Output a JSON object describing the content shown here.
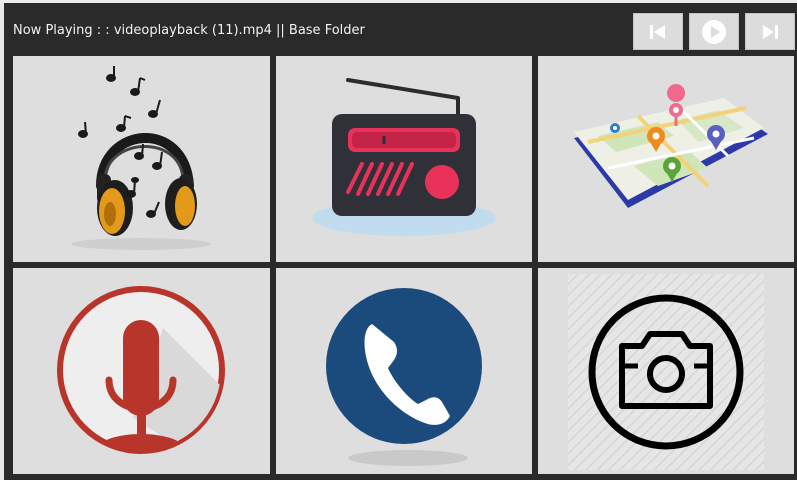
{
  "header": {
    "now_playing_text": "Now Playing : : videoplayback (11).mp4 || Base Folder"
  },
  "controls": [
    {
      "id": "prev",
      "icon": "skip-previous-icon"
    },
    {
      "id": "play",
      "icon": "play-icon"
    },
    {
      "id": "next",
      "icon": "skip-next-icon"
    }
  ],
  "tiles": [
    {
      "id": "music",
      "icon": "headphones-music-icon"
    },
    {
      "id": "radio",
      "icon": "radio-icon"
    },
    {
      "id": "maps",
      "icon": "map-icon"
    },
    {
      "id": "voice",
      "icon": "microphone-icon"
    },
    {
      "id": "phone",
      "icon": "phone-icon"
    },
    {
      "id": "camera",
      "icon": "camera-icon"
    }
  ],
  "colors": {
    "background": "#2a2a2a",
    "tile": "#dedede",
    "radio_accent": "#e8325a",
    "mic_red": "#b8352b",
    "phone_blue": "#1b4a7c",
    "map_road": "#2b3aa8"
  }
}
